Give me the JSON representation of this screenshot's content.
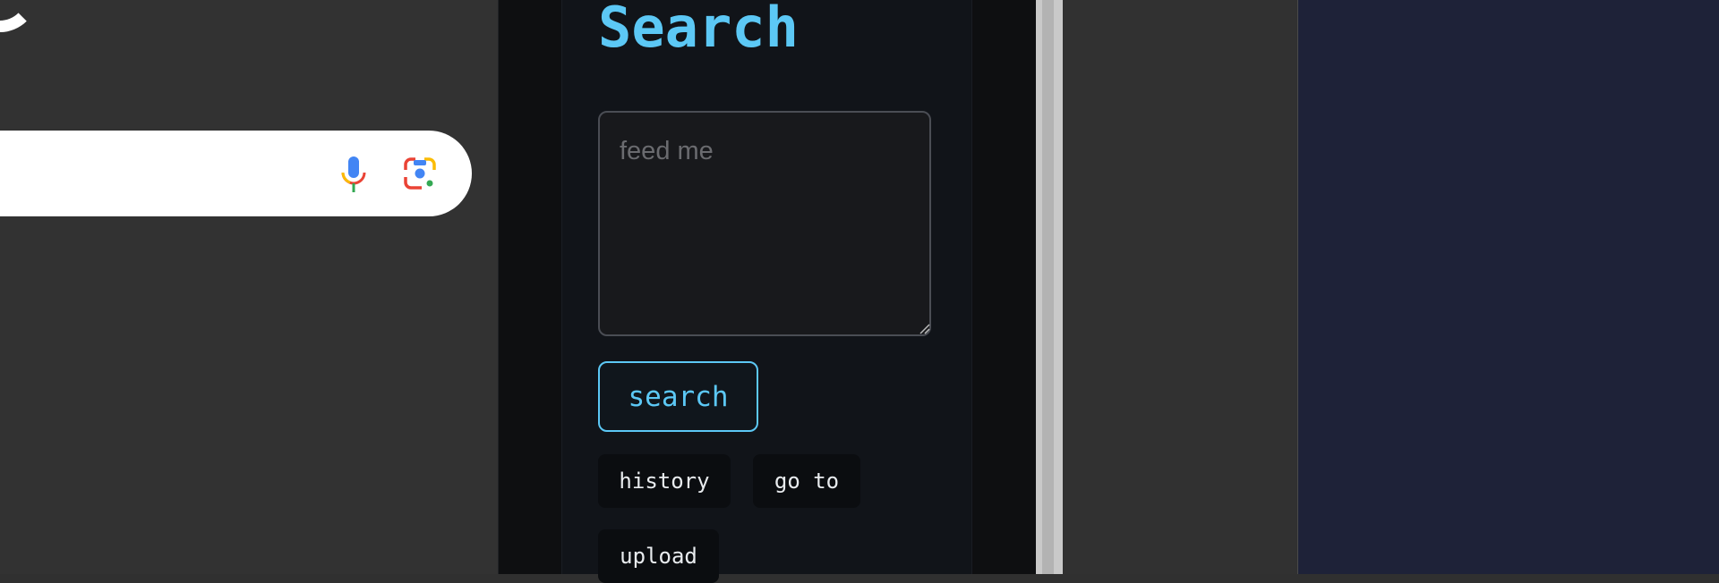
{
  "background_window": {
    "icons": [
      "logo-fragment",
      "mic-icon",
      "google-lens-icon"
    ]
  },
  "search_panel": {
    "title": "Search",
    "query_placeholder": "feed me",
    "query_value": "",
    "search_button_label": "search",
    "buttons": [
      "history",
      "go to",
      "upload"
    ]
  },
  "colors": {
    "accent": "#5cc8f5",
    "panel_background": "#111419",
    "chip_background": "#0b0d10",
    "right_pane_background": "#1e2238"
  }
}
